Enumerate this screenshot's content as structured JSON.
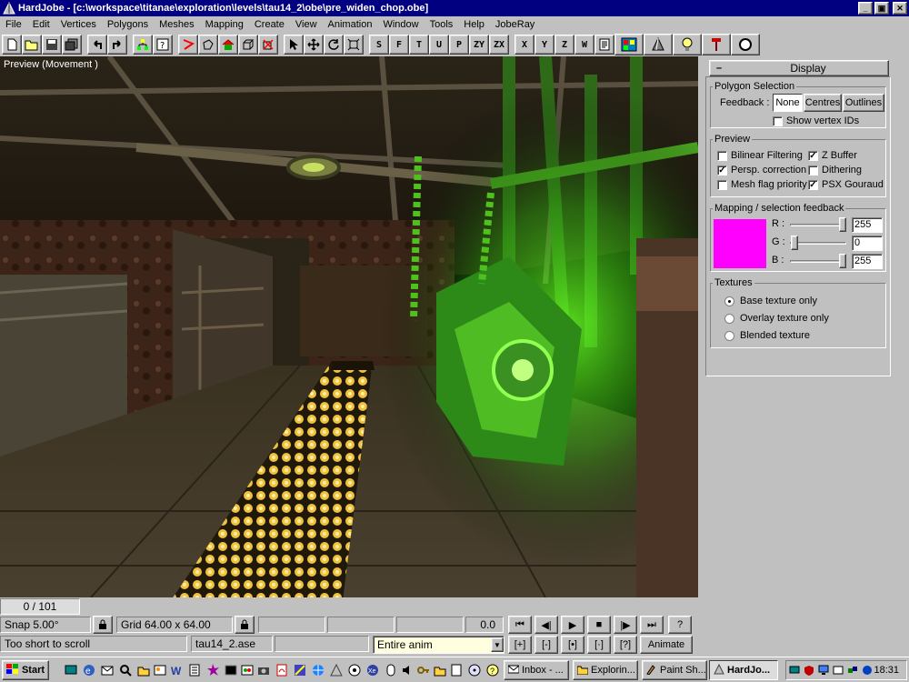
{
  "window": {
    "title": "HardJobe - [c:\\workspace\\titanae\\exploration\\levels\\tau14_2\\obe\\pre_widen_chop.obe]",
    "minimize_glyph": "_",
    "restore_glyph": "▣",
    "close_glyph": "✕"
  },
  "menu": [
    "File",
    "Edit",
    "Vertices",
    "Polygons",
    "Meshes",
    "Mapping",
    "Create",
    "View",
    "Animation",
    "Window",
    "Tools",
    "Help",
    "JobeRay"
  ],
  "toolbar": {
    "snap_buttons": [
      "S",
      "F",
      "T",
      "U",
      "P",
      "ZY",
      "ZX"
    ],
    "axis_buttons": [
      "X",
      "Y",
      "Z",
      "W"
    ]
  },
  "viewport": {
    "label": "Preview (Movement )"
  },
  "panel": {
    "collapse_glyph": "–",
    "header": "Display",
    "polygon_selection": {
      "legend": "Polygon Selection",
      "feedback_label": "Feedback :",
      "buttons": [
        "None",
        "Centres",
        "Outlines"
      ],
      "show_vertex_ids": "Show vertex IDs"
    },
    "preview": {
      "legend": "Preview",
      "bilinear": "Bilinear Filtering",
      "zbuffer": "Z Buffer",
      "persp": "Persp. correction",
      "dithering": "Dithering",
      "meshflag": "Mesh flag priority",
      "psx": "PSX Gouraud"
    },
    "mapping": {
      "legend": "Mapping / selection feedback",
      "color": "#ff00ff",
      "r_label": "R :",
      "g_label": "G :",
      "b_label": "B :",
      "r": "255",
      "g": "0",
      "b": "255"
    },
    "textures": {
      "legend": "Textures",
      "base": "Base texture only",
      "overlay": "Overlay texture only",
      "blended": "Blended texture"
    }
  },
  "bottom": {
    "frame_counter": "0 / 101",
    "snap": "Snap 5.00°",
    "grid": "Grid 64.00 x 64.00",
    "time": "0.0",
    "status_message": "Too short to scroll",
    "file_name": "tau14_2.ase",
    "anim_select": "Entire anim",
    "animate_button": "Animate",
    "help_button": "?",
    "playback": [
      "⏮",
      "◀|",
      "▶",
      "■",
      "|▶",
      "⏭"
    ],
    "keys": [
      "[+]",
      "[-]",
      "[•]",
      "[·]",
      "[?]"
    ]
  },
  "taskbar": {
    "start": "Start",
    "tasks": [
      "Inbox - ...",
      "Explorin...",
      "Paint Sh...",
      "HardJo..."
    ],
    "clock": "18:31"
  }
}
